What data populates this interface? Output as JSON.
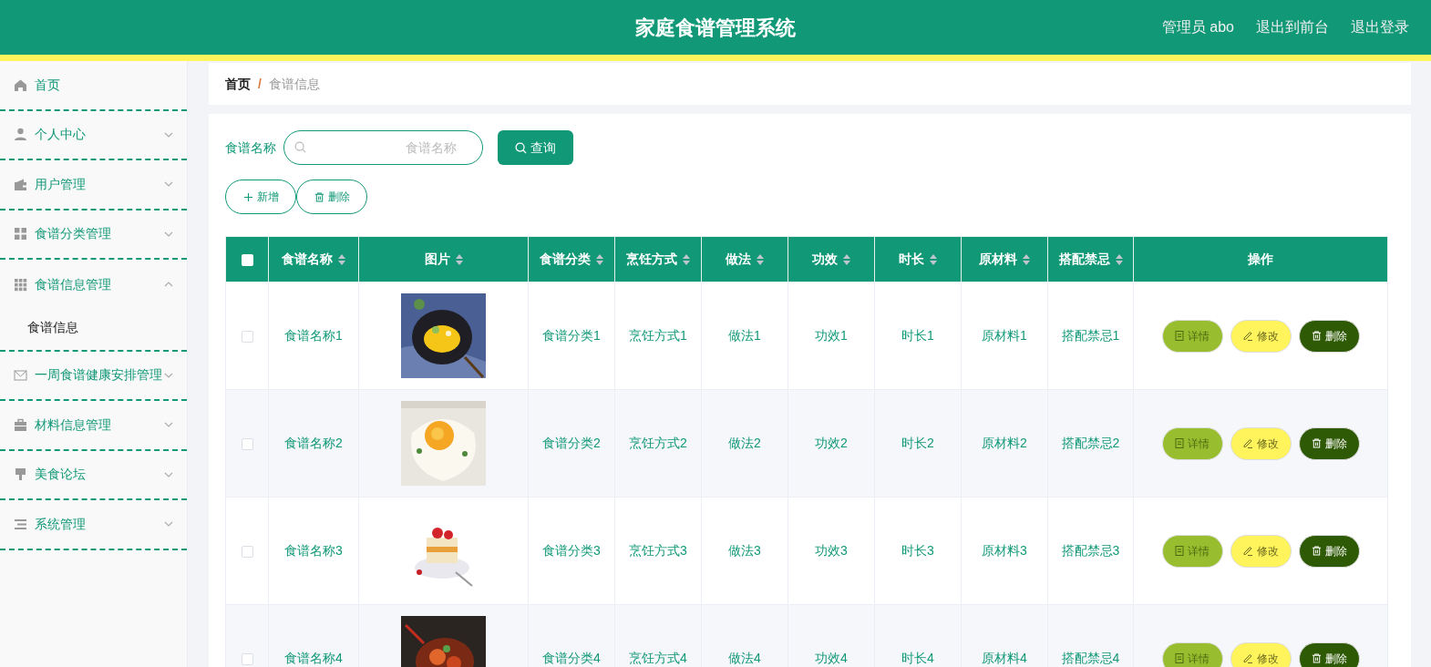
{
  "header": {
    "title": "家庭食谱管理系统",
    "links": [
      "管理员 abo",
      "退出到前台",
      "退出登录"
    ]
  },
  "sidebar": {
    "items": [
      {
        "label": "首页"
      },
      {
        "label": "个人中心",
        "expanded": false
      },
      {
        "label": "用户管理",
        "expanded": false
      },
      {
        "label": "食谱分类管理",
        "expanded": false
      },
      {
        "label": "食谱信息管理",
        "expanded": true,
        "children": [
          {
            "label": "食谱信息",
            "selected": true
          }
        ]
      },
      {
        "label": "一周食谱健康安排管理",
        "expanded": false
      },
      {
        "label": "材料信息管理",
        "expanded": false
      },
      {
        "label": "美食论坛",
        "expanded": false
      },
      {
        "label": "系统管理",
        "expanded": false
      }
    ]
  },
  "breadcrumb": {
    "separator": "/",
    "items": [
      "首页",
      "食谱信息"
    ]
  },
  "search": {
    "label": "食谱名称",
    "placeholder": "食谱名称",
    "button": "查询"
  },
  "toolbar": [
    "新增",
    "删除"
  ],
  "table": {
    "select_all": {
      "checked": false
    },
    "columns": [
      {
        "label": "食谱名称",
        "sortable": true
      },
      {
        "label": "图片",
        "sortable": true
      },
      {
        "label": "食谱分类",
        "sortable": true
      },
      {
        "label": "烹饪方式",
        "sortable": true
      },
      {
        "label": "做法",
        "sortable": true
      },
      {
        "label": "功效",
        "sortable": true
      },
      {
        "label": "时长",
        "sortable": true
      },
      {
        "label": "原材料",
        "sortable": true
      },
      {
        "label": "搭配禁忌",
        "sortable": true
      },
      {
        "label": "操作",
        "sortable": false
      }
    ],
    "rows": [
      {
        "checked": false,
        "cells": [
          "食谱名称1",
          {
            "kind": "picture"
          },
          "食谱分类1",
          "烹饪方式1",
          "做法1",
          "功效1",
          "时长1",
          "原材料1",
          "搭配禁忌1"
        ],
        "actions": [
          "详情",
          "修改",
          "删除"
        ]
      },
      {
        "checked": false,
        "cells": [
          "食谱名称2",
          {
            "kind": "picture"
          },
          "食谱分类2",
          "烹饪方式2",
          "做法2",
          "功效2",
          "时长2",
          "原材料2",
          "搭配禁忌2"
        ],
        "actions": [
          "详情",
          "修改",
          "删除"
        ]
      },
      {
        "checked": false,
        "cells": [
          "食谱名称3",
          {
            "kind": "picture"
          },
          "食谱分类3",
          "烹饪方式3",
          "做法3",
          "功效3",
          "时长3",
          "原材料3",
          "搭配禁忌3"
        ],
        "actions": [
          "详情",
          "修改",
          "删除"
        ]
      },
      {
        "checked": false,
        "cells": [
          "食谱名称4",
          {
            "kind": "picture"
          },
          "食谱分类4",
          "烹饪方式4",
          "做法4",
          "功效4",
          "时长4",
          "原材料4",
          "搭配禁忌4"
        ],
        "actions": [
          "详情",
          "修改",
          "删除"
        ]
      }
    ]
  }
}
